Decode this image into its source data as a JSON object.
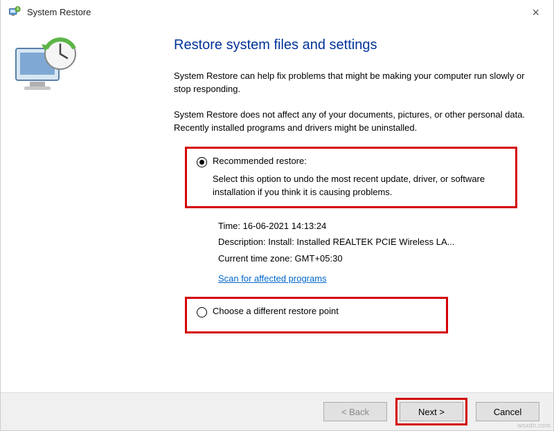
{
  "titlebar": {
    "title": "System Restore"
  },
  "content": {
    "heading": "Restore system files and settings",
    "intro1": "System Restore can help fix problems that might be making your computer run slowly or stop responding.",
    "intro2": "System Restore does not affect any of your documents, pictures, or other personal data. Recently installed programs and drivers might be uninstalled.",
    "option_recommended": {
      "label": "Recommended restore:",
      "desc": "Select this option to undo the most recent update, driver, or software installation if you think it is causing problems."
    },
    "details": {
      "time_label": "Time: ",
      "time_value": "16-06-2021 14:13:24",
      "desc_label": "Description: ",
      "desc_value": "Install: Installed REALTEK PCIE Wireless LA...",
      "tz_label": "Current time zone: ",
      "tz_value": "GMT+05:30",
      "scan_link": "Scan for affected programs"
    },
    "option_different": {
      "label": "Choose a different restore point"
    }
  },
  "footer": {
    "back": "< Back",
    "next": "Next >",
    "cancel": "Cancel"
  },
  "watermark": "wsxdn.com"
}
